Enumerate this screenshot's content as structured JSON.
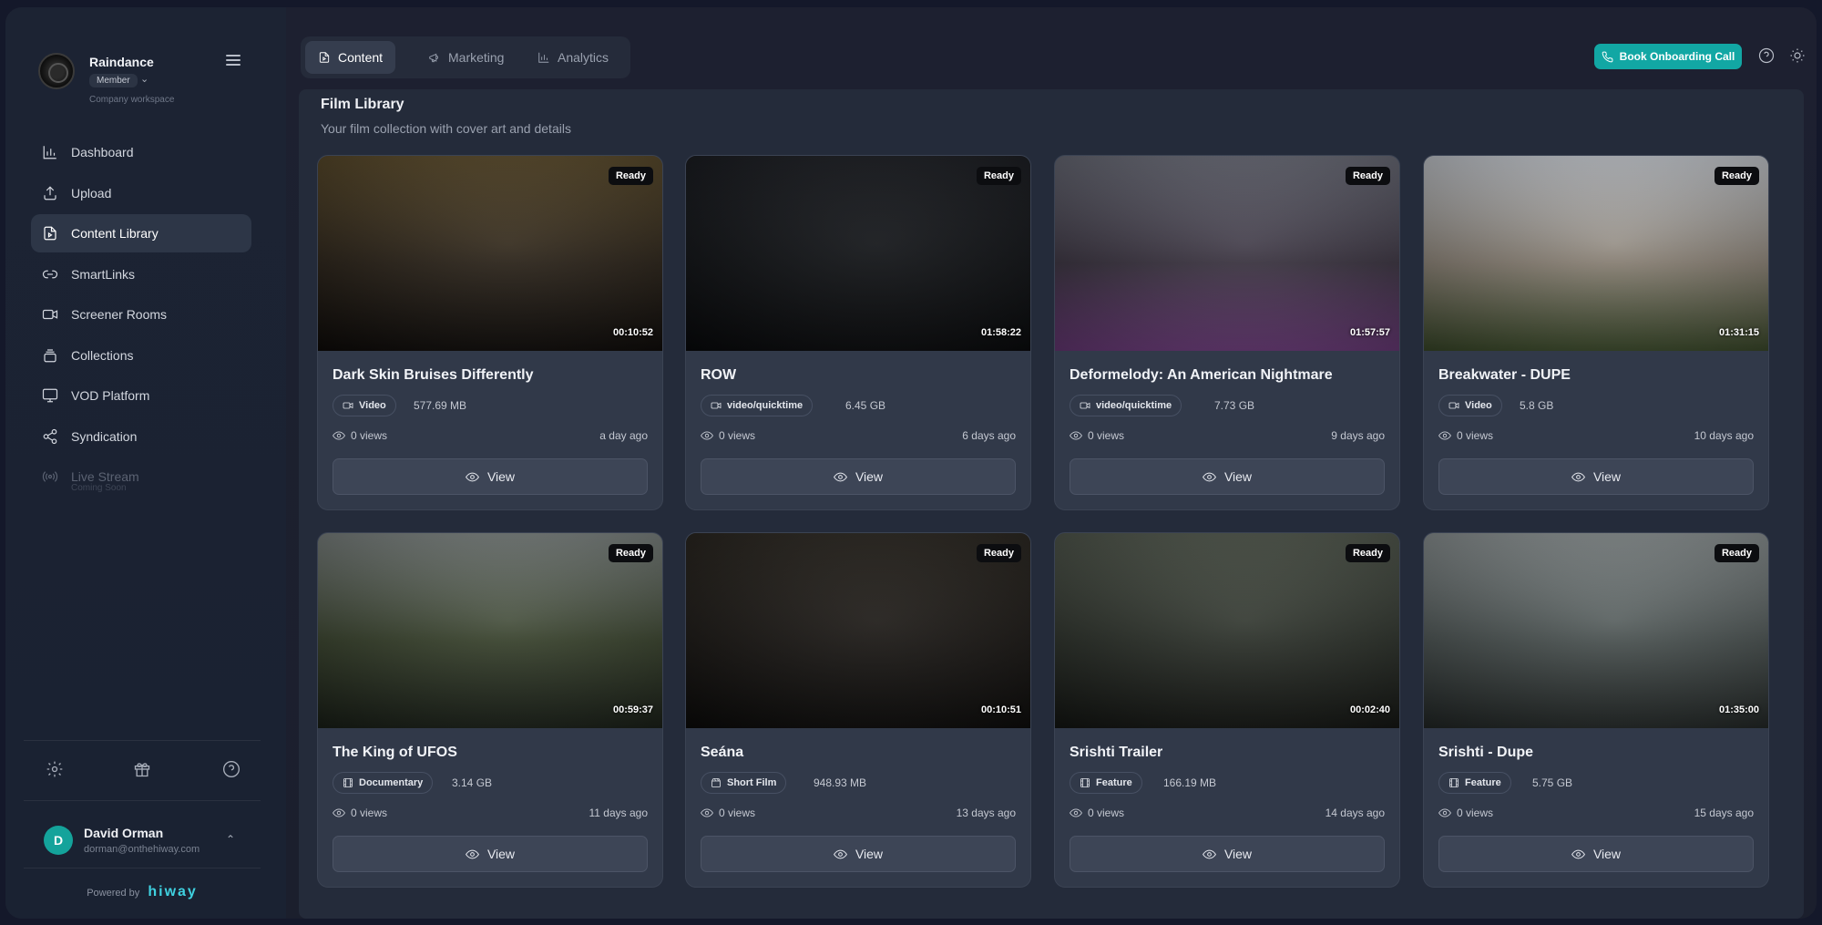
{
  "workspace": {
    "name": "Raindance",
    "role": "Member",
    "subtitle": "Company workspace"
  },
  "nav": {
    "items": [
      {
        "label": "Dashboard"
      },
      {
        "label": "Upload"
      },
      {
        "label": "Content Library"
      },
      {
        "label": "SmartLinks"
      },
      {
        "label": "Screener Rooms"
      },
      {
        "label": "Collections"
      },
      {
        "label": "VOD Platform"
      },
      {
        "label": "Syndication"
      },
      {
        "label": "Live Stream",
        "sub": "Coming Soon"
      }
    ],
    "active": "Content Library"
  },
  "user": {
    "initial": "D",
    "name": "David Orman",
    "email": "dorman@onthehiway.com"
  },
  "footer": {
    "powered_label": "Powered by",
    "brand": "hiway"
  },
  "tabs": [
    {
      "label": "Content"
    },
    {
      "label": "Marketing"
    },
    {
      "label": "Analytics"
    }
  ],
  "header": {
    "cta_label": "Book Onboarding Call"
  },
  "library": {
    "title": "Film Library",
    "subtitle": "Your film collection with cover art and details",
    "view_label": "View",
    "cards": [
      {
        "title": "Dark Skin Bruises Differently",
        "status": "Ready",
        "duration": "00:10:52",
        "type": "Video",
        "type_icon": "video-icon",
        "size": "577.69 MB",
        "views": "0 views",
        "age": "a day ago",
        "thumb_palette": [
          "#5a4a2a",
          "#2a2218",
          "#0e0b09"
        ]
      },
      {
        "title": "ROW",
        "status": "Ready",
        "duration": "01:58:22",
        "type": "video/quicktime",
        "type_icon": "video-icon",
        "size": "6.45 GB",
        "views": "0 views",
        "age": "6 days ago",
        "thumb_palette": [
          "#1a1c21",
          "#0f1114",
          "#08090b"
        ]
      },
      {
        "title": "Deformelody: An American Nightmare",
        "status": "Ready",
        "duration": "01:57:57",
        "type": "video/quicktime",
        "type_icon": "video-icon",
        "size": "7.73 GB",
        "views": "0 views",
        "age": "9 days ago",
        "thumb_palette": [
          "#6a6c78",
          "#3a3340",
          "#6b3a7a"
        ]
      },
      {
        "title": "Breakwater - DUPE",
        "status": "Ready",
        "duration": "01:31:15",
        "type": "Video",
        "type_icon": "video-icon",
        "size": "5.8 GB",
        "views": "0 views",
        "age": "10 days ago",
        "thumb_palette": [
          "#c8ccd2",
          "#8b8276",
          "#3b4a2a"
        ]
      },
      {
        "title": "The King of UFOS",
        "status": "Ready",
        "duration": "00:59:37",
        "type": "Documentary",
        "type_icon": "film-icon",
        "size": "3.14 GB",
        "views": "0 views",
        "age": "11 days ago",
        "thumb_palette": [
          "#7e8583",
          "#39432d",
          "#1a2018"
        ]
      },
      {
        "title": "Seána",
        "status": "Ready",
        "duration": "00:10:51",
        "type": "Short Film",
        "type_icon": "clapper-icon",
        "size": "948.93 MB",
        "views": "0 views",
        "age": "13 days ago",
        "thumb_palette": [
          "#2a2620",
          "#1a1714",
          "#0c0b0a"
        ]
      },
      {
        "title": "Srishti Trailer",
        "status": "Ready",
        "duration": "00:02:40",
        "type": "Feature",
        "type_icon": "film-icon",
        "size": "166.19 MB",
        "views": "0 views",
        "age": "14 days ago",
        "thumb_palette": [
          "#52594e",
          "#2c312a",
          "#141613"
        ]
      },
      {
        "title": "Srishti - Dupe",
        "status": "Ready",
        "duration": "01:35:00",
        "type": "Feature",
        "type_icon": "film-icon",
        "size": "5.75 GB",
        "views": "0 views",
        "age": "15 days ago",
        "thumb_palette": [
          "#8e9596",
          "#4b5352",
          "#232827"
        ]
      }
    ]
  }
}
